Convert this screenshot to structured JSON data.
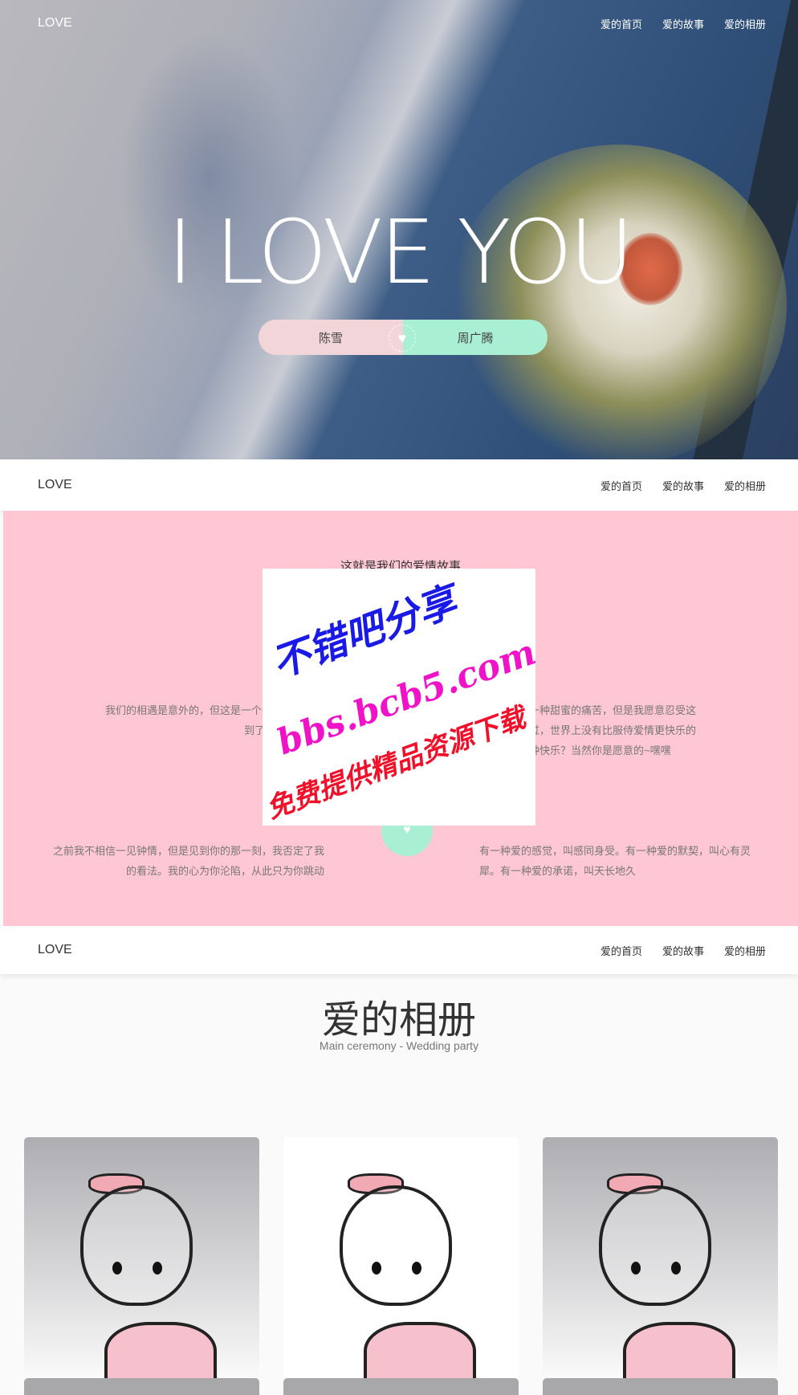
{
  "nav": {
    "logo": "LOVE",
    "items": [
      "爱的首页",
      "爱的故事",
      "爱的相册"
    ]
  },
  "hero": {
    "title": "I LOVE YOU",
    "left_name": "陈雪",
    "right_name": "周广腾",
    "heart_icon": "heart-icon"
  },
  "story": {
    "title": "这就是我们的爱情故事",
    "p1": [
      "我们的相遇是意外的，但这是一个美丽幸福的意",
      "到了"
    ],
    "p2": [
      "过：爱情是一种甜蜜的痛苦，但是我愿意忍受这",
      "士比亚还说过，世界上没有比服侍爱情更快乐的",
      "愿意享受这种快乐？当然你是愿意的~嘿嘿"
    ],
    "p3": [
      "之前我不相信一见钟情，但是见到你的那一刻，我否定了我",
      "的看法。我的心为你沦陷，从此只为你跳动"
    ],
    "p4": [
      "有一种爱的感觉，叫感同身受。有一种爱的默契，叫心有灵",
      "犀。有一种爱的承诺，叫天长地久"
    ],
    "colors": {
      "pink": "#fec7d3",
      "mint": "#a8efd3"
    }
  },
  "watermark": {
    "line1": "不错吧分享",
    "line2": "bbs.bcb5.com",
    "line3": "免费提供精品资源下载"
  },
  "gallery": {
    "title": "爱的相册",
    "subtitle": "Main ceremony - Wedding party"
  }
}
